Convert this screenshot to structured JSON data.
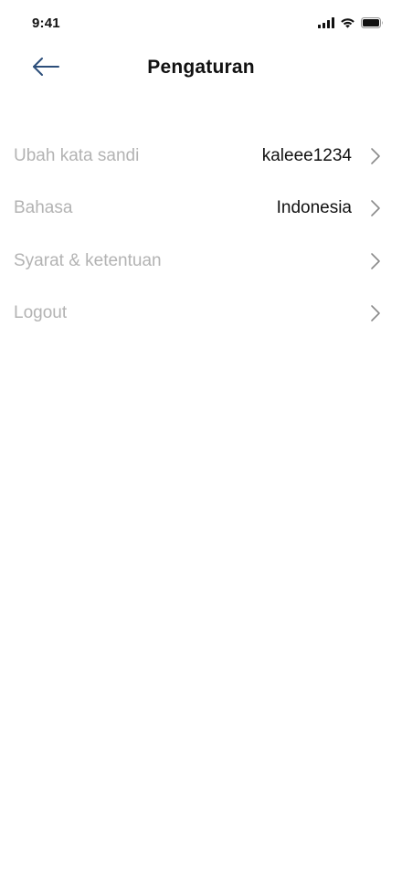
{
  "status_bar": {
    "time": "9:41",
    "icons": [
      "cellular-signal-icon",
      "wifi-icon",
      "battery-icon"
    ]
  },
  "header": {
    "title": "Pengaturan",
    "back_icon": "arrow-left-icon"
  },
  "settings": {
    "items": [
      {
        "label": "Ubah kata sandi",
        "value": "kaleee1234"
      },
      {
        "label": "Bahasa",
        "value": "Indonesia"
      },
      {
        "label": "Syarat & ketentuan",
        "value": ""
      },
      {
        "label": "Logout",
        "value": ""
      }
    ]
  },
  "colors": {
    "label_gray": "#b3b3b3",
    "text_dark": "#111111",
    "back_arrow_blue": "#2c4e7a",
    "chevron_gray": "#8a8a8a"
  }
}
